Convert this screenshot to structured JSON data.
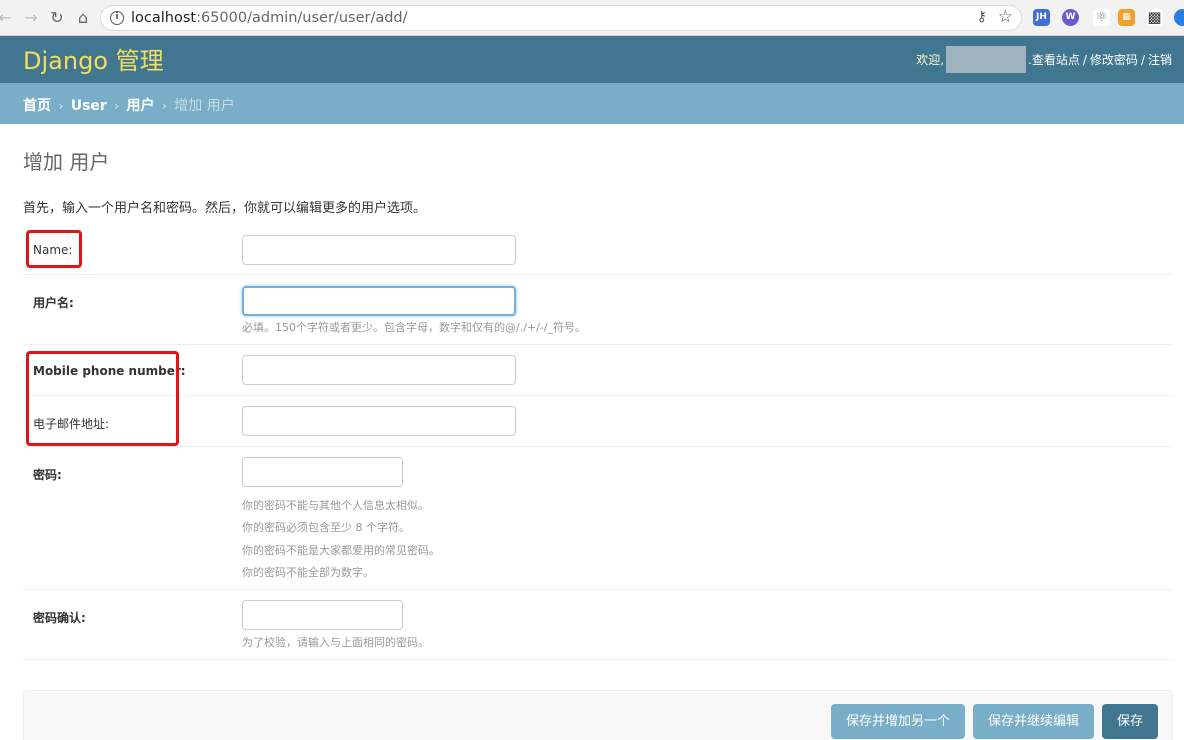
{
  "browser": {
    "url_host": "localhost",
    "url_rest": ":65000/admin/user/user/add/",
    "extensions": [
      {
        "name": "jh-icon",
        "label": "JH",
        "color": "#3d6fd6"
      },
      {
        "name": "web-icon",
        "label": "W",
        "color": "#6a5acd"
      },
      {
        "name": "react-icon",
        "label": "⚛",
        "color": "#888"
      },
      {
        "name": "orange-ext-icon",
        "label": "▦",
        "color": "#f0a030"
      },
      {
        "name": "qr-icon",
        "label": "▩",
        "color": "#333"
      }
    ]
  },
  "header": {
    "brand": "Django 管理",
    "welcome": "欢迎,",
    "view_site": "查看站点",
    "change_password": "修改密码",
    "logout": "注销",
    "separator": "/"
  },
  "breadcrumbs": {
    "home": "首页",
    "app": "User",
    "model": "用户",
    "current": "增加 用户",
    "separator": "›"
  },
  "page": {
    "title": "增加 用户",
    "intro": "首先，输入一个用户名和密码。然后，你就可以编辑更多的用户选项。"
  },
  "form": {
    "name_label": "Name:",
    "username_label": "用户名:",
    "username_help": "必填。150个字符或者更少。包含字母，数字和仅有的@/./+/-/_符号。",
    "mobile_label": "Mobile phone number:",
    "email_label": "电子邮件地址:",
    "password_label": "密码:",
    "password_help": [
      "你的密码不能与其他个人信息太相似。",
      "你的密码必须包含至少 8 个字符。",
      "你的密码不能是大家都爱用的常见密码。",
      "你的密码不能全部为数字。"
    ],
    "password2_label": "密码确认:",
    "password2_help": "为了校验，请输入与上面相同的密码。"
  },
  "buttons": {
    "save_add_another": "保存并增加另一个",
    "save_continue": "保存并继续编辑",
    "save": "保存"
  },
  "colors": {
    "header_bg": "#417690",
    "breadcrumb_bg": "#79aec8",
    "brand": "#f5dd5d",
    "highlight": "#e0151b"
  }
}
